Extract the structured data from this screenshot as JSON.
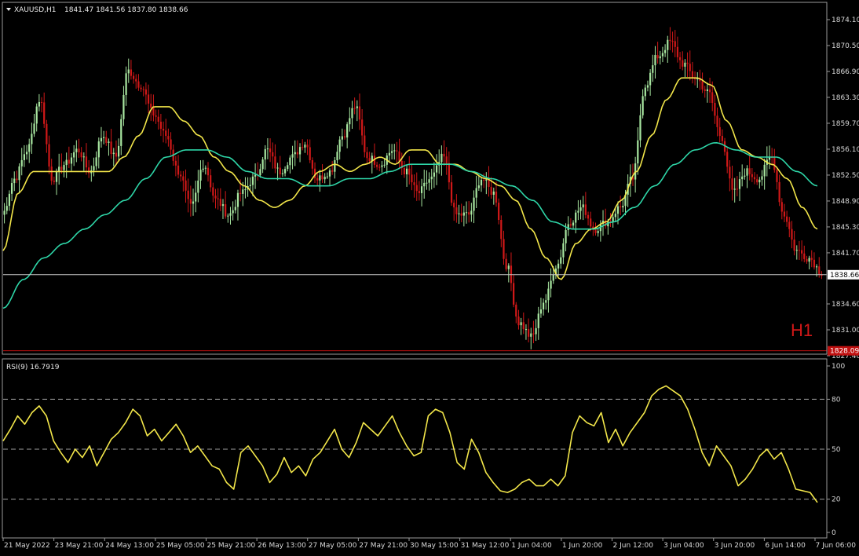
{
  "header": {
    "symbol": "XAUUSD,H1",
    "ohlc": "1841.47 1841.56 1837.80 1838.66",
    "timeframe": "H1"
  },
  "rsi_header": "RSI(9) 16.7919",
  "colors": {
    "background": "#000000",
    "bull": "#a8e6a0",
    "bear": "#d01818",
    "ma_fast": "#f2e64a",
    "ma_slow": "#2ed6a8",
    "rsi": "#f2e64a",
    "bid_line": "#c8c8c8",
    "low_line": "#c01010"
  },
  "chart_data": [
    {
      "name": "price",
      "type": "candlestick",
      "ylim": [
        1827.4,
        1876.0
      ],
      "y_ticks": [
        "1874.10",
        "1870.50",
        "1866.90",
        "1863.30",
        "1859.70",
        "1856.10",
        "1852.50",
        "1848.90",
        "1845.30",
        "1841.70",
        "1834.60",
        "1831.00",
        "1827.40"
      ],
      "x_ticks": [
        "21 May 2022",
        "23 May 21:00",
        "24 May 13:00",
        "25 May 05:00",
        "25 May 21:00",
        "26 May 13:00",
        "27 May 05:00",
        "27 May 21:00",
        "30 May 15:00",
        "31 May 12:00",
        "1 Jun 04:00",
        "1 Jun 20:00",
        "2 Jun 12:00",
        "3 Jun 04:00",
        "3 Jun 20:00",
        "6 Jun 14:00",
        "7 Jun 06:00"
      ],
      "bid_price": "1838.66",
      "low_line_price": "1828.09",
      "anchors": [
        1847,
        1852,
        1856,
        1863,
        1852,
        1854,
        1856,
        1853,
        1858,
        1855,
        1867,
        1865,
        1861,
        1858,
        1853,
        1848,
        1854,
        1849,
        1847,
        1850,
        1852,
        1856,
        1853,
        1855,
        1857,
        1852,
        1853,
        1858,
        1862,
        1855,
        1854,
        1856,
        1853,
        1850,
        1852,
        1855,
        1847,
        1847,
        1852,
        1850,
        1840,
        1832,
        1830,
        1835,
        1840,
        1846,
        1848,
        1845,
        1846,
        1848,
        1852,
        1865,
        1869,
        1871,
        1868,
        1866,
        1864,
        1858,
        1850,
        1853,
        1852,
        1855,
        1847,
        1842,
        1841,
        1839
      ],
      "series": [
        {
          "name": "MA fast",
          "anchors": [
            1842,
            1850,
            1853,
            1853,
            1853,
            1853,
            1853,
            1853,
            1855,
            1858,
            1862,
            1862,
            1860,
            1858,
            1855,
            1853,
            1851,
            1849,
            1848,
            1849,
            1851,
            1853,
            1854,
            1853,
            1854,
            1855,
            1854,
            1856,
            1856,
            1854,
            1854,
            1853,
            1852,
            1851,
            1849,
            1845,
            1841,
            1838,
            1843,
            1845,
            1846,
            1849,
            1853,
            1858,
            1863,
            1866,
            1866,
            1865,
            1860,
            1856,
            1855,
            1854,
            1852,
            1848,
            1845
          ]
        },
        {
          "name": "MA slow",
          "anchors": [
            1834,
            1838,
            1841,
            1843,
            1845,
            1847,
            1849,
            1852,
            1855,
            1856,
            1856,
            1855,
            1853,
            1852,
            1852,
            1851,
            1851,
            1852,
            1852,
            1853,
            1854,
            1854,
            1854,
            1853,
            1852,
            1851,
            1849,
            1846,
            1845,
            1845,
            1846,
            1848,
            1851,
            1854,
            1856,
            1857,
            1856,
            1855,
            1855,
            1853,
            1851
          ]
        }
      ]
    },
    {
      "name": "rsi",
      "type": "line",
      "ylim": [
        0,
        100
      ],
      "y_ticks": [
        "100",
        "80",
        "50",
        "20",
        "0"
      ],
      "levels": [
        80,
        50,
        20
      ],
      "series": [
        {
          "name": "RSI(9)",
          "values": [
            55,
            62,
            70,
            65,
            72,
            76,
            70,
            55,
            48,
            42,
            50,
            45,
            52,
            40,
            48,
            56,
            60,
            66,
            74,
            70,
            58,
            62,
            55,
            60,
            65,
            58,
            48,
            52,
            46,
            40,
            38,
            30,
            26,
            48,
            52,
            46,
            40,
            30,
            35,
            45,
            36,
            40,
            34,
            44,
            48,
            55,
            62,
            50,
            45,
            54,
            66,
            62,
            58,
            64,
            70,
            60,
            52,
            46,
            48,
            70,
            74,
            72,
            60,
            42,
            38,
            56,
            48,
            36,
            30,
            25,
            24,
            26,
            30,
            32,
            28,
            28,
            32,
            28,
            34,
            60,
            70,
            66,
            64,
            72,
            54,
            62,
            52,
            60,
            66,
            72,
            82,
            86,
            88,
            85,
            82,
            74,
            62,
            48,
            40,
            52,
            46,
            40,
            28,
            32,
            38,
            46,
            50,
            44,
            48,
            38,
            26,
            25,
            24,
            18
          ]
        }
      ]
    }
  ]
}
